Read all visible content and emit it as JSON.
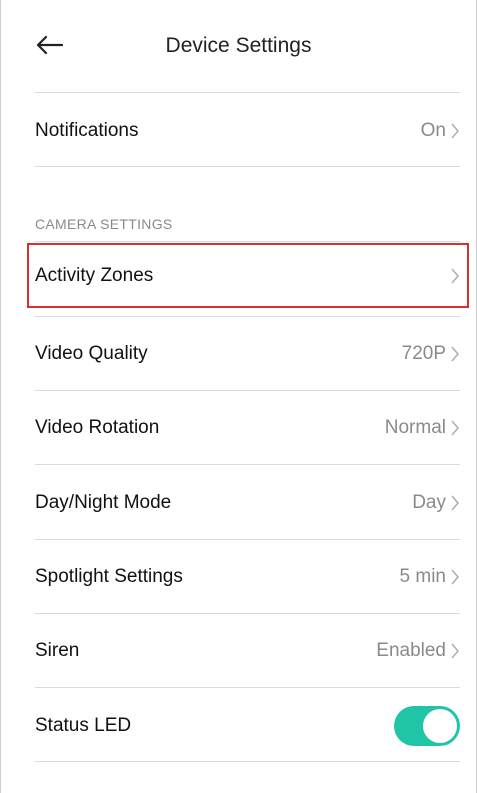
{
  "header": {
    "title": "Device Settings"
  },
  "notifications": {
    "label": "Notifications",
    "value": "On"
  },
  "camera_section": {
    "label": "CAMERA SETTINGS"
  },
  "rows": [
    {
      "label": "Activity Zones",
      "value": ""
    },
    {
      "label": "Video Quality",
      "value": "720P"
    },
    {
      "label": "Video Rotation",
      "value": "Normal"
    },
    {
      "label": "Day/Night Mode",
      "value": "Day"
    },
    {
      "label": "Spotlight Settings",
      "value": "5 min"
    },
    {
      "label": "Siren",
      "value": "Enabled"
    }
  ],
  "status_led": {
    "label": "Status LED",
    "enabled": true
  },
  "colors": {
    "toggle_on": "#1fc5a6",
    "highlight": "#d93030",
    "value_text": "#8a8a8a"
  },
  "icons": {
    "back": "arrow-left-icon",
    "chevron": "chevron-right-icon"
  }
}
